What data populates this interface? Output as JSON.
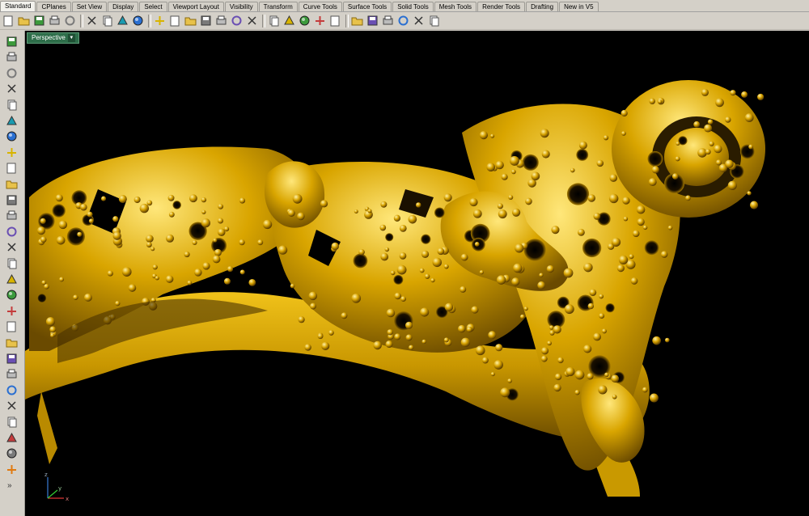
{
  "tabs": [
    {
      "label": "Standard",
      "active": true
    },
    {
      "label": "CPlanes"
    },
    {
      "label": "Set View"
    },
    {
      "label": "Display"
    },
    {
      "label": "Select"
    },
    {
      "label": "Viewport Layout"
    },
    {
      "label": "Visibility"
    },
    {
      "label": "Transform"
    },
    {
      "label": "Curve Tools"
    },
    {
      "label": "Surface Tools"
    },
    {
      "label": "Solid Tools"
    },
    {
      "label": "Mesh Tools"
    },
    {
      "label": "Render Tools"
    },
    {
      "label": "Drafting"
    },
    {
      "label": "New in V5"
    }
  ],
  "toolbar_icons": [
    "new-icon",
    "open-icon",
    "save-icon",
    "print-icon",
    "import-icon",
    "cut-icon",
    "copy-icon",
    "paste-icon",
    "undo-icon",
    "pan-icon",
    "rotate-view-icon",
    "zoom-window-icon",
    "zoom-extents-icon",
    "zoom-selected-icon",
    "undo-view-icon",
    "grid-icon",
    "hide-icon",
    "show-icon",
    "lock-icon",
    "light-icon",
    "layer-icon",
    "color-wheel-icon",
    "material-icon",
    "render-icon",
    "snap-icon",
    "options-icon",
    "help-icon"
  ],
  "left_tools": [
    "select-arrow-icon",
    "point-icon",
    "polyline-icon",
    "curve-icon",
    "circle-icon",
    "arc-icon",
    "ellipse-icon",
    "polygon-icon",
    "rectangle-icon",
    "freeform-icon",
    "offset-icon",
    "curve-edit-icon",
    "surface-icon",
    "box-icon",
    "sphere-icon",
    "extrude-icon",
    "boolean-icon",
    "mesh-icon",
    "move-icon",
    "array-icon",
    "fillet-icon",
    "trim-icon",
    "split-icon",
    "text-icon",
    "dimension-icon",
    "group-icon",
    "analyze-icon",
    "render-material-icon",
    "more-icon"
  ],
  "viewport": {
    "title": "Perspective",
    "gold_color": "#d4a000",
    "axes": {
      "x": "x",
      "y": "y",
      "z": "z"
    }
  }
}
